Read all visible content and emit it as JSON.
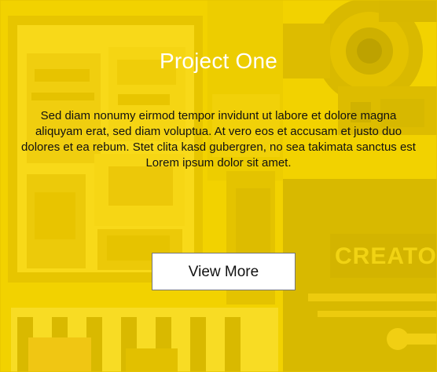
{
  "card": {
    "title": "Project One",
    "description": "Sed diam nonumy eirmod tempor invidunt ut labore et dolore magna aliquyam erat, sed diam voluptua. At vero eos et accusam et justo duo dolores et ea rebum. Stet clita kasd gubergren, no sea takimata sanctus est Lorem ipsum dolor sit amet.",
    "button_label": "View More",
    "overlay_color": "#FFDD00",
    "background_image_text": "CREATOR"
  }
}
